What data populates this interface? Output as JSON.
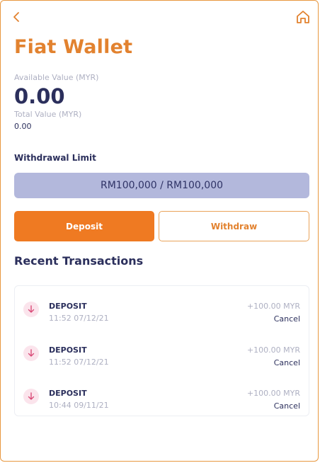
{
  "header": {
    "title": "Fiat Wallet",
    "back_icon": "chevron-left-icon",
    "home_icon": "home-icon"
  },
  "balance": {
    "available_label": "Available Value (MYR)",
    "available_value": "0.00",
    "total_label": "Total Value (MYR)",
    "total_value": "0.00"
  },
  "withdrawal": {
    "label": "Withdrawal Limit",
    "value": "RM100,000 / RM100,000"
  },
  "actions": {
    "deposit_label": "Deposit",
    "withdraw_label": "Withdraw"
  },
  "transactions": {
    "title": "Recent Transactions",
    "items": [
      {
        "type": "DEPOSIT",
        "time": "11:52 07/12/21",
        "amount": "+100.00 MYR",
        "status": "Cancel",
        "icon": "arrow-down-icon"
      },
      {
        "type": "DEPOSIT",
        "time": "11:52 07/12/21",
        "amount": "+100.00 MYR",
        "status": "Cancel",
        "icon": "arrow-down-icon"
      },
      {
        "type": "DEPOSIT",
        "time": "10:44 09/11/21",
        "amount": "+100.00 MYR",
        "status": "Cancel",
        "icon": "arrow-down-icon"
      }
    ]
  },
  "colors": {
    "accent": "#e2822f",
    "primary_button": "#ef7a22",
    "navy_text": "#2b2f5c",
    "muted_text": "#aeb0c2",
    "limit_bar": "#b3b8dc",
    "tx_icon_bg": "#fbe4ec",
    "tx_icon_arrow": "#d94b78"
  }
}
